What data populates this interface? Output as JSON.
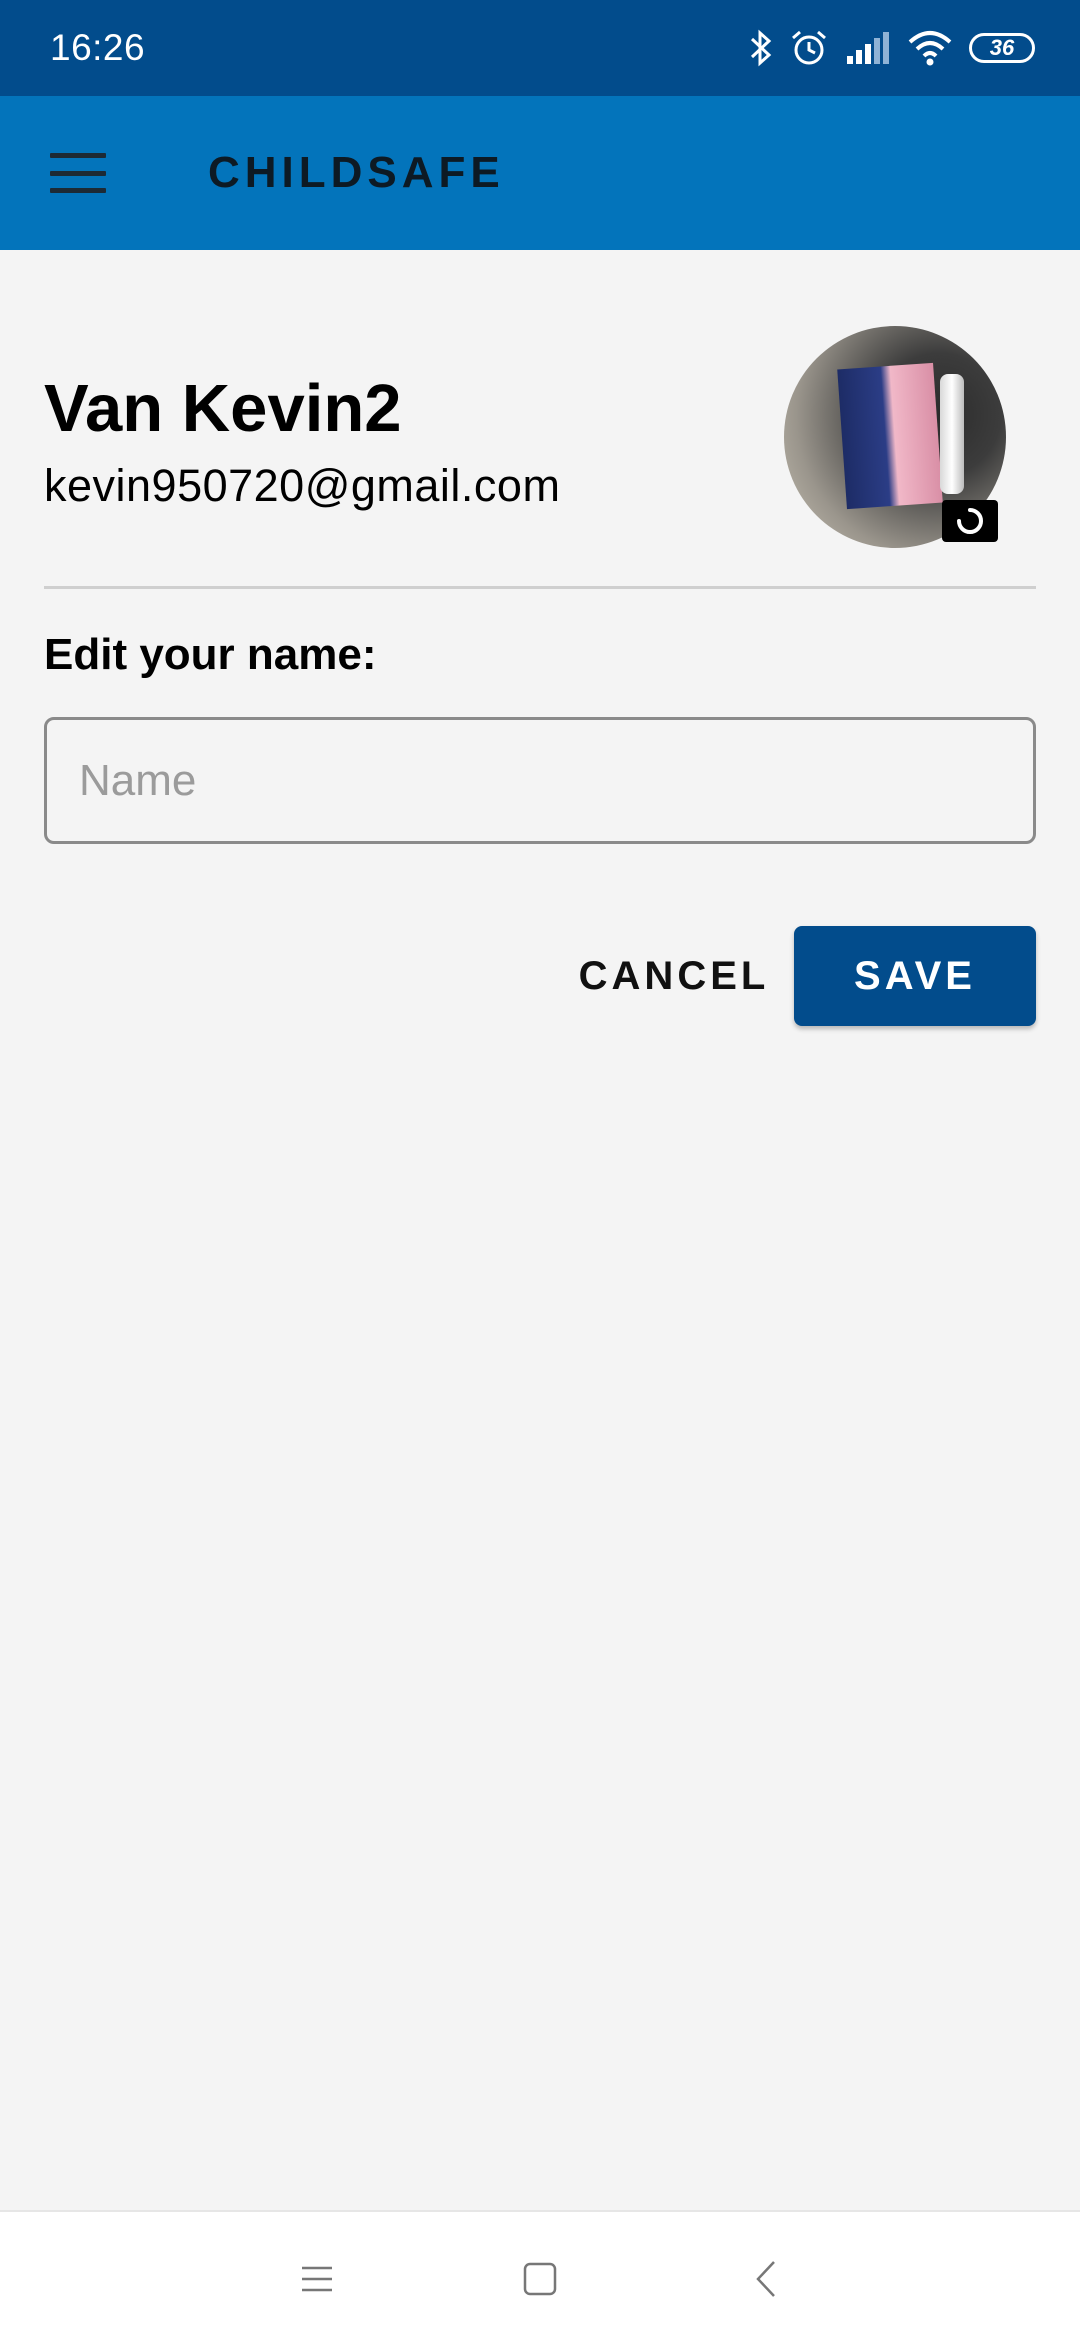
{
  "status_bar": {
    "time": "16:26",
    "icons": [
      "bluetooth-icon",
      "alarm-icon",
      "signal-icon",
      "wifi-icon"
    ],
    "battery": "36"
  },
  "app_bar": {
    "title": "CHILDSAFE",
    "menu_icon": "hamburger-menu-icon"
  },
  "profile": {
    "name": "Van Kevin2",
    "email": "kevin950720@gmail.com",
    "avatar_edit_icon": "loading-spinner-icon"
  },
  "form": {
    "label": "Edit your name:",
    "name_value": "",
    "name_placeholder": "Name"
  },
  "actions": {
    "cancel_label": "CANCEL",
    "save_label": "SAVE"
  },
  "nav_bar": {
    "icons": [
      "recents-icon",
      "home-icon",
      "back-icon"
    ]
  },
  "colors": {
    "status_bar": "#024c8c",
    "app_bar": "#0374bb",
    "background": "#f4f4f4",
    "save_button": "#024c8c"
  }
}
